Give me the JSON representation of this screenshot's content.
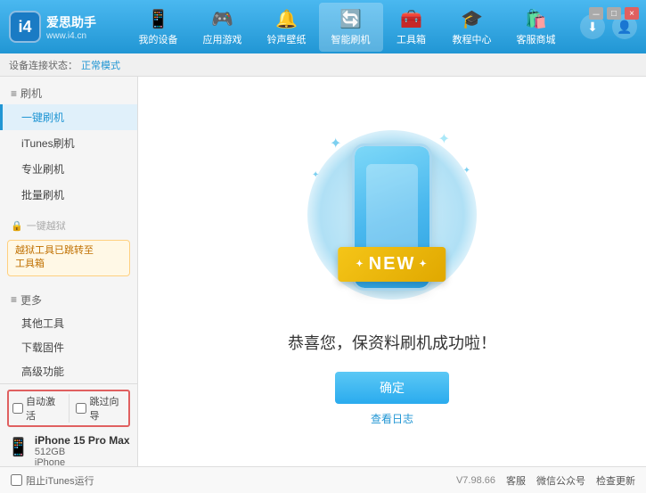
{
  "app": {
    "brand": "爱思助手",
    "url": "www.i4.cn",
    "logo_char": "i4"
  },
  "nav": {
    "items": [
      {
        "id": "my-device",
        "label": "我的设备",
        "icon": "📱"
      },
      {
        "id": "apps-games",
        "label": "应用游戏",
        "icon": "🎮"
      },
      {
        "id": "ringtones",
        "label": "铃声壁纸",
        "icon": "🔔"
      },
      {
        "id": "smart-flash",
        "label": "智能刷机",
        "icon": "🔄",
        "active": true
      },
      {
        "id": "toolbox",
        "label": "工具箱",
        "icon": "🧰"
      },
      {
        "id": "tutorial",
        "label": "教程中心",
        "icon": "🎓"
      },
      {
        "id": "service",
        "label": "客服商城",
        "icon": "🛍️"
      }
    ]
  },
  "breadcrumb": {
    "mode_label": "设备连接状态：",
    "mode_value": "正常模式"
  },
  "sidebar": {
    "section_flash": "刷机",
    "items": [
      {
        "id": "one-key-flash",
        "label": "一键刷机",
        "active": true
      },
      {
        "id": "itunes-flash",
        "label": "iTunes刷机"
      },
      {
        "id": "pro-flash",
        "label": "专业刷机"
      },
      {
        "id": "batch-flash",
        "label": "批量刷机"
      }
    ],
    "disabled_label": "一键越狱",
    "warning_text": "越狱工具已跳转至\n工具箱",
    "section_more": "更多",
    "more_items": [
      {
        "id": "other-tools",
        "label": "其他工具"
      },
      {
        "id": "download-firmware",
        "label": "下载固件"
      },
      {
        "id": "advanced",
        "label": "高级功能"
      }
    ],
    "checkbox_auto": "自动激活",
    "checkbox_guide": "跳过向导",
    "device": {
      "name": "iPhone 15 Pro Max",
      "storage": "512GB",
      "type": "iPhone"
    }
  },
  "content": {
    "new_badge": "NEW",
    "success_text": "恭喜您，保资料刷机成功啦！",
    "confirm_button": "确定",
    "view_log": "查看日志"
  },
  "statusbar": {
    "itunes_label": "阻止iTunes运行",
    "version": "V7.98.66",
    "links": [
      "客服",
      "微信公众号",
      "检查更新"
    ]
  },
  "win_controls": {
    "minimize": "－",
    "maximize": "□",
    "close": "×"
  }
}
